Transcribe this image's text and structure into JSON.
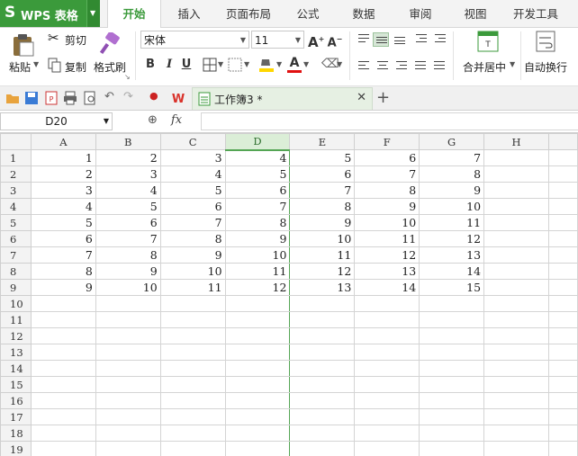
{
  "app": {
    "logo_letter": "S",
    "name": "WPS 表格"
  },
  "menu_tabs": [
    "开始",
    "插入",
    "页面布局",
    "公式",
    "数据",
    "审阅",
    "视图",
    "开发工具"
  ],
  "active_tab": "开始",
  "ribbon": {
    "paste": "粘贴",
    "cut": "剪切",
    "copy": "复制",
    "format_painter": "格式刷",
    "font_name": "宋体",
    "font_size": "11",
    "bold": "B",
    "italic": "I",
    "underline": "U",
    "font_color_glyph": "A",
    "merge_center": "合并居中",
    "wrap_text": "自动换行"
  },
  "document_tab": {
    "title": "工作簿3 *"
  },
  "formula_bar": {
    "name_box": "D20",
    "fx": "fx",
    "value": ""
  },
  "sheet": {
    "columns": [
      "A",
      "B",
      "C",
      "D",
      "E",
      "F",
      "G",
      "H"
    ],
    "selected_column": "D",
    "row_numbers": [
      "1",
      "2",
      "3",
      "4",
      "5",
      "6",
      "7",
      "8",
      "9",
      "10",
      "11",
      "12",
      "13",
      "14",
      "15",
      "16",
      "17",
      "18",
      "19"
    ],
    "rows": [
      [
        "1",
        "2",
        "3",
        "4",
        "5",
        "6",
        "7",
        ""
      ],
      [
        "2",
        "3",
        "4",
        "5",
        "6",
        "7",
        "8",
        ""
      ],
      [
        "3",
        "4",
        "5",
        "6",
        "7",
        "8",
        "9",
        ""
      ],
      [
        "4",
        "5",
        "6",
        "7",
        "8",
        "9",
        "10",
        ""
      ],
      [
        "5",
        "6",
        "7",
        "8",
        "9",
        "10",
        "11",
        ""
      ],
      [
        "6",
        "7",
        "8",
        "9",
        "10",
        "11",
        "12",
        ""
      ],
      [
        "7",
        "8",
        "9",
        "10",
        "11",
        "12",
        "13",
        ""
      ],
      [
        "8",
        "9",
        "10",
        "11",
        "12",
        "13",
        "14",
        ""
      ],
      [
        "9",
        "10",
        "11",
        "12",
        "13",
        "14",
        "15",
        ""
      ]
    ]
  },
  "colors": {
    "accent": "#3b9a3b",
    "selected_header": "#dbeed7",
    "gridline": "#d4d4d4"
  }
}
